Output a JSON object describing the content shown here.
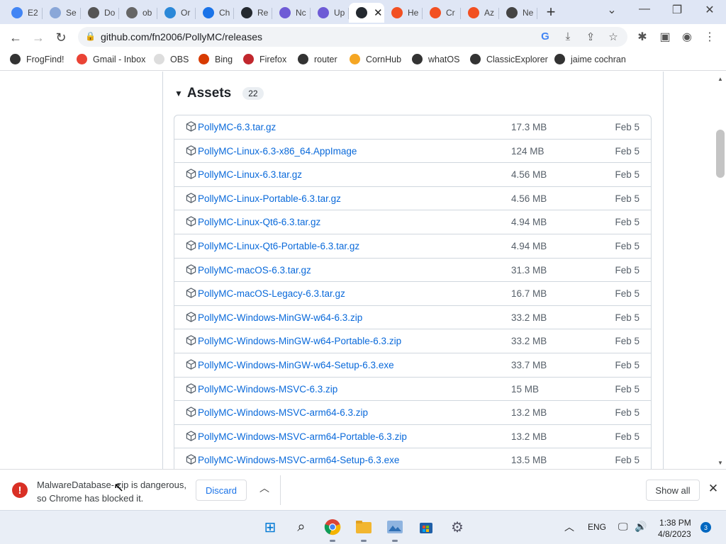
{
  "browser": {
    "tabs": [
      {
        "label": "E2",
        "icon": "google-icon",
        "color": "#4285f4"
      },
      {
        "label": "Se",
        "icon": "github-icon",
        "color": "#8aa7d8"
      },
      {
        "label": "Do",
        "icon": "download-icon",
        "color": "#555555"
      },
      {
        "label": "ob",
        "icon": "globe-icon",
        "color": "#666666"
      },
      {
        "label": "Or",
        "icon": "app-icon",
        "color": "#2b88d8"
      },
      {
        "label": "Ch",
        "icon": "chat-icon",
        "color": "#1a73e8"
      },
      {
        "label": "Re",
        "icon": "github-icon",
        "color": "#24292f"
      },
      {
        "label": "Nc",
        "icon": "hex-icon",
        "color": "#6e5bd6"
      },
      {
        "label": "Up",
        "icon": "hex-icon",
        "color": "#6e5bd6"
      },
      {
        "label": "",
        "icon": "github-icon",
        "color": "#24292f",
        "active": true
      },
      {
        "label": "He",
        "icon": "microsoft-icon",
        "color": "#f25022"
      },
      {
        "label": "Cr",
        "icon": "microsoft-icon",
        "color": "#f25022"
      },
      {
        "label": "Az",
        "icon": "microsoft-icon",
        "color": "#f25022"
      },
      {
        "label": "Ne",
        "icon": "globe-icon",
        "color": "#444444"
      }
    ],
    "url": "github.com/fn2006/PollyMC/releases"
  },
  "bookmarks": [
    {
      "label": "FrogFind!",
      "color": "#333333"
    },
    {
      "label": "Gmail - Inbox",
      "color": "#ea4335"
    },
    {
      "label": "OBS",
      "color": "#dddddd"
    },
    {
      "label": "Bing",
      "color": "#d83b01"
    },
    {
      "label": "Firefox",
      "color": "#c1272d"
    },
    {
      "label": "router",
      "color": "#333333"
    },
    {
      "label": "CornHub",
      "color": "#f5a623"
    },
    {
      "label": "whatOS",
      "color": "#333333"
    },
    {
      "label": "ClassicExplorer",
      "color": "#333333"
    },
    {
      "label": "jaime cochran",
      "color": "#333333"
    }
  ],
  "assets": {
    "title": "Assets",
    "count": "22",
    "items": [
      {
        "name": "PollyMC-6.3.tar.gz",
        "size": "17.3 MB",
        "date": "Feb 5"
      },
      {
        "name": "PollyMC-Linux-6.3-x86_64.AppImage",
        "size": "124 MB",
        "date": "Feb 5"
      },
      {
        "name": "PollyMC-Linux-6.3.tar.gz",
        "size": "4.56 MB",
        "date": "Feb 5"
      },
      {
        "name": "PollyMC-Linux-Portable-6.3.tar.gz",
        "size": "4.56 MB",
        "date": "Feb 5"
      },
      {
        "name": "PollyMC-Linux-Qt6-6.3.tar.gz",
        "size": "4.94 MB",
        "date": "Feb 5"
      },
      {
        "name": "PollyMC-Linux-Qt6-Portable-6.3.tar.gz",
        "size": "4.94 MB",
        "date": "Feb 5"
      },
      {
        "name": "PollyMC-macOS-6.3.tar.gz",
        "size": "31.3 MB",
        "date": "Feb 5"
      },
      {
        "name": "PollyMC-macOS-Legacy-6.3.tar.gz",
        "size": "16.7 MB",
        "date": "Feb 5"
      },
      {
        "name": "PollyMC-Windows-MinGW-w64-6.3.zip",
        "size": "33.2 MB",
        "date": "Feb 5"
      },
      {
        "name": "PollyMC-Windows-MinGW-w64-Portable-6.3.zip",
        "size": "33.2 MB",
        "date": "Feb 5"
      },
      {
        "name": "PollyMC-Windows-MinGW-w64-Setup-6.3.exe",
        "size": "33.7 MB",
        "date": "Feb 5"
      },
      {
        "name": "PollyMC-Windows-MSVC-6.3.zip",
        "size": "15 MB",
        "date": "Feb 5"
      },
      {
        "name": "PollyMC-Windows-MSVC-arm64-6.3.zip",
        "size": "13.2 MB",
        "date": "Feb 5"
      },
      {
        "name": "PollyMC-Windows-MSVC-arm64-Portable-6.3.zip",
        "size": "13.2 MB",
        "date": "Feb 5"
      },
      {
        "name": "PollyMC-Windows-MSVC-arm64-Setup-6.3.exe",
        "size": "13.5 MB",
        "date": "Feb 5"
      }
    ]
  },
  "download_bar": {
    "message": "MalwareDatabase-.zip is dangerous, so Chrome has blocked it.",
    "discard_label": "Discard",
    "show_all_label": "Show all"
  },
  "taskbar": {
    "language": "ENG",
    "time": "1:38 PM",
    "date": "4/8/2023",
    "notification_count": "3"
  },
  "colors": {
    "link": "#0969da",
    "muted": "#57606a",
    "error": "#d93025",
    "accent": "#1a73e8"
  }
}
